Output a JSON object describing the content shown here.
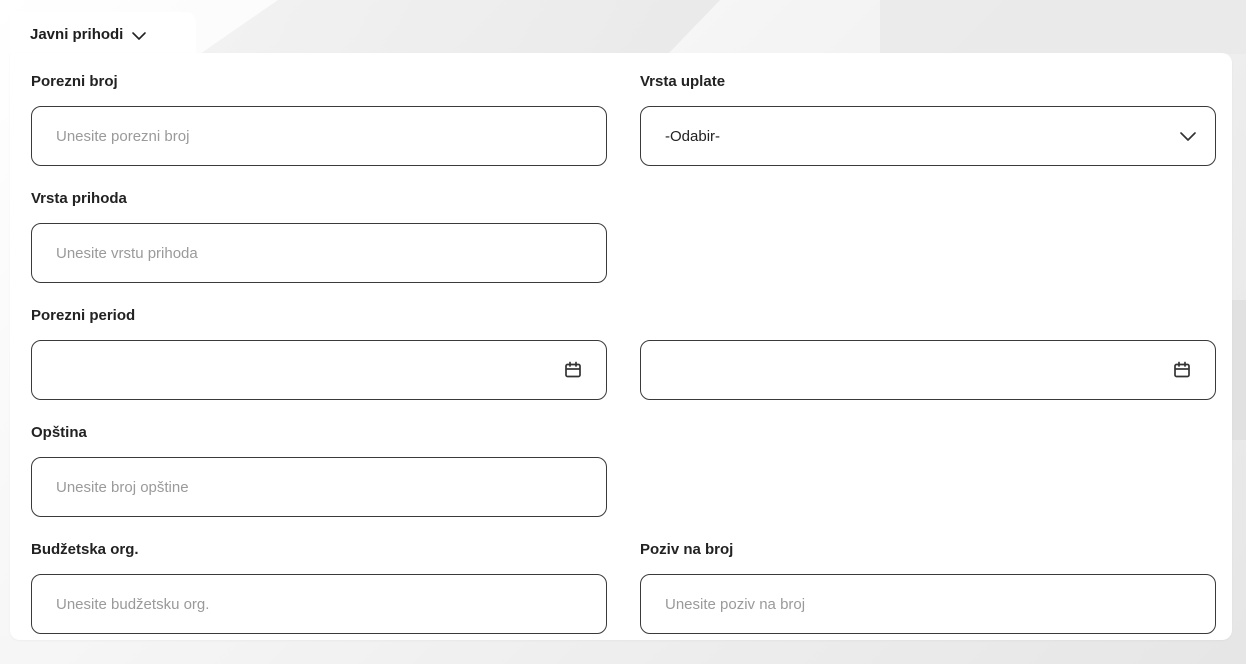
{
  "tab": {
    "label": "Javni prihodi"
  },
  "form": {
    "porezni_broj": {
      "label": "Porezni broj",
      "placeholder": "Unesite porezni broj",
      "value": ""
    },
    "vrsta_uplate": {
      "label": "Vrsta uplate",
      "selected": "-Odabir-"
    },
    "vrsta_prihoda": {
      "label": "Vrsta prihoda",
      "placeholder": "Unesite vrstu prihoda",
      "value": ""
    },
    "porezni_period": {
      "label": "Porezni period",
      "from_value": "",
      "to_value": ""
    },
    "opstina": {
      "label": "Opština",
      "placeholder": "Unesite broj opštine",
      "value": ""
    },
    "budzetska_org": {
      "label": "Budžetska org.",
      "placeholder": "Unesite budžetsku org.",
      "value": ""
    },
    "poziv_na_broj": {
      "label": "Poziv na broj",
      "placeholder": "Unesite poziv na broj",
      "value": ""
    }
  },
  "icons": {
    "tab_chevron": "chevron-down-icon",
    "select_chevron": "chevron-down-icon",
    "date": "calendar-icon"
  },
  "colors": {
    "border": "#3a3a3a",
    "placeholder": "#9a9a9a",
    "text": "#222222",
    "card": "#ffffff"
  }
}
